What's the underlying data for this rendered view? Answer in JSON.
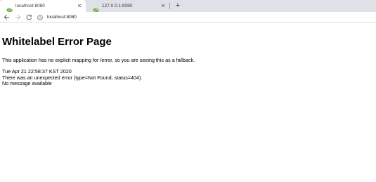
{
  "browser": {
    "tabs": [
      {
        "title": "localhost:8080",
        "active": true,
        "close": "×"
      },
      {
        "title": "127.0.0.1:8080",
        "active": false,
        "close": "×"
      }
    ],
    "new_tab": "+",
    "address_bar": {
      "url": "localhost:8080"
    },
    "nav_icons": [
      "back-arrow-icon",
      "forward-arrow-icon",
      "reload-icon",
      "info-icon"
    ],
    "favicon": "spring-leaf-icon",
    "colors": {
      "tabstrip": "#dee1e6",
      "favicon": "#6db33f"
    }
  },
  "page": {
    "title": "Whitelabel Error Page",
    "message": "This application has no explicit mapping for /error, so you are seeing this as a fallback.",
    "timestamp": "Tue Apr 21 22:58:37 KST 2020",
    "error_line": "There was an unexpected error (type=Not Found, status=404).",
    "detail": "No message available"
  }
}
